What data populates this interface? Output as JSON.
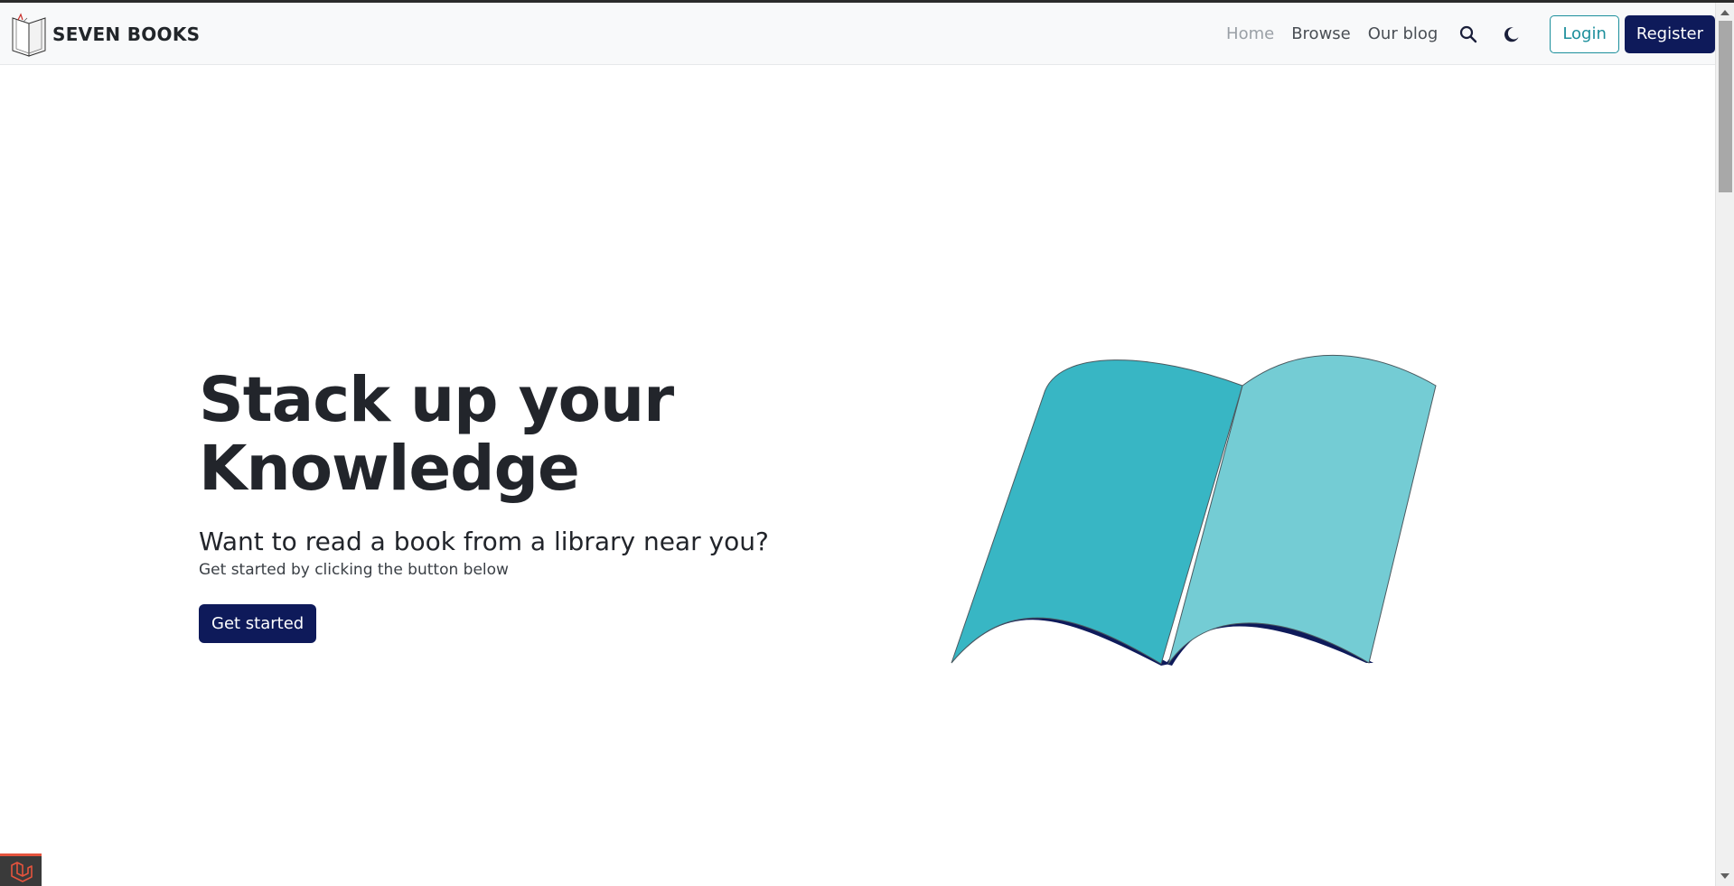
{
  "brand": {
    "name": "SEVEN BOOKS",
    "logo_icon": "open-book-logo-icon"
  },
  "nav": {
    "links": [
      {
        "label": "Home",
        "active": true
      },
      {
        "label": "Browse",
        "active": false
      },
      {
        "label": "Our blog",
        "active": false
      }
    ],
    "search_icon": "search-icon",
    "theme_icon": "moon-icon",
    "login_label": "Login",
    "register_label": "Register"
  },
  "hero": {
    "title_line1": "Stack up your",
    "title_line2": "Knowledge",
    "subtitle": "Want to read a book from a library near you?",
    "text": "Get started by clicking the button below",
    "cta_label": "Get started",
    "illustration": "open-book-illustration"
  },
  "debug_badge_icon": "laravel-icon",
  "colors": {
    "primary_navy": "#0e1a5a",
    "teal_outline": "#1c8f9c",
    "book_left_page": "#38b6c4",
    "book_right_page": "#74ccd4",
    "book_cover": "#0e1a5a",
    "navbar_bg": "#f8f9fa"
  }
}
